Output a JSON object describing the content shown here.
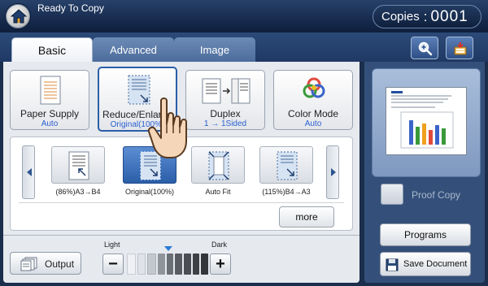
{
  "status": {
    "text": "Ready To Copy"
  },
  "copies": {
    "label": "Copies",
    "value": "0001"
  },
  "tabs": [
    {
      "label": "Basic",
      "active": true
    },
    {
      "label": "Advanced",
      "active": false
    },
    {
      "label": "Image",
      "active": false
    }
  ],
  "toolbar": {
    "zoom_icon": "zoom-in-icon",
    "job_icon": "job-status-icon"
  },
  "functions": [
    {
      "label": "Paper Supply",
      "value": "Auto",
      "icon": "paper-supply-icon"
    },
    {
      "label": "Reduce/Enlarge",
      "value": "Original(100%)",
      "icon": "reduce-enlarge-icon",
      "selected": true
    },
    {
      "label": "Duplex",
      "value": "1 → 1Sided",
      "icon": "duplex-icon"
    },
    {
      "label": "Color Mode",
      "value": "Auto",
      "icon": "color-mode-icon"
    }
  ],
  "reduce_options": [
    {
      "label": "(86%)A3→B4",
      "selected": false
    },
    {
      "label": "Original(100%)",
      "selected": true
    },
    {
      "label": "Auto Fit",
      "selected": false
    },
    {
      "label": "(115%)B4→A3",
      "selected": false
    }
  ],
  "more_label": "more",
  "output": {
    "label": "Output"
  },
  "density": {
    "light_label": "Light",
    "dark_label": "Dark",
    "level": 0.5,
    "minus": "−",
    "plus": "+"
  },
  "right_panel": {
    "proof_copy_label": "Proof Copy",
    "programs_label": "Programs",
    "save_document_label": "Save Document"
  },
  "colors": {
    "accent": "#2a5fa8",
    "value_text": "#2a5fcf",
    "topbar": "#15284a"
  }
}
